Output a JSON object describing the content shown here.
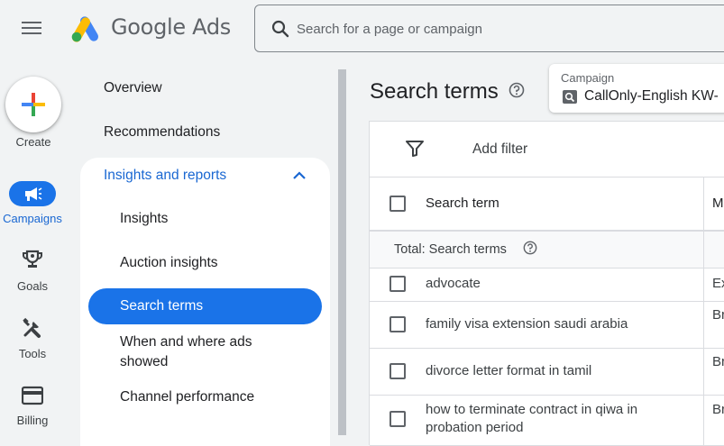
{
  "header": {
    "brand_label": "Google Ads",
    "search_placeholder": "Search for a page or campaign"
  },
  "rail": {
    "create_label": "Create",
    "campaigns_label": "Campaigns",
    "goals_label": "Goals",
    "tools_label": "Tools",
    "billing_label": "Billing"
  },
  "nav": {
    "overview": "Overview",
    "recommendations": "Recommendations",
    "insights_reports": "Insights and reports",
    "sub": {
      "insights": "Insights",
      "auction_insights": "Auction insights",
      "search_terms": "Search terms",
      "when_where_1": "When and where ads",
      "when_where_2": "showed",
      "channel_performance": "Channel performance"
    }
  },
  "main": {
    "title": "Search terms",
    "campaign_label": "Campaign",
    "campaign_value": "CallOnly-English KW-",
    "add_filter": "Add filter",
    "col_search_term": "Search term",
    "col_match": "M",
    "total_label": "Total: Search terms",
    "rows": [
      {
        "term": "advocate",
        "match": "Ex"
      },
      {
        "term": "family visa extension saudi arabia",
        "match": "Br m"
      },
      {
        "term": "divorce letter format in tamil",
        "match": "Br m"
      },
      {
        "term": "how to terminate contract in qiwa in probation period",
        "match": "Br m"
      }
    ]
  },
  "colors": {
    "accent": "#1a73e8",
    "accent_text": "#1967d2",
    "background": "#f1f3f4"
  },
  "icons": [
    "menu-icon",
    "google-ads-logo",
    "search-icon",
    "plus-icon",
    "megaphone-icon",
    "trophy-icon",
    "tools-icon",
    "credit-card-icon",
    "chevron-up-icon",
    "help-icon",
    "filter-icon",
    "campaign-search-icon"
  ]
}
